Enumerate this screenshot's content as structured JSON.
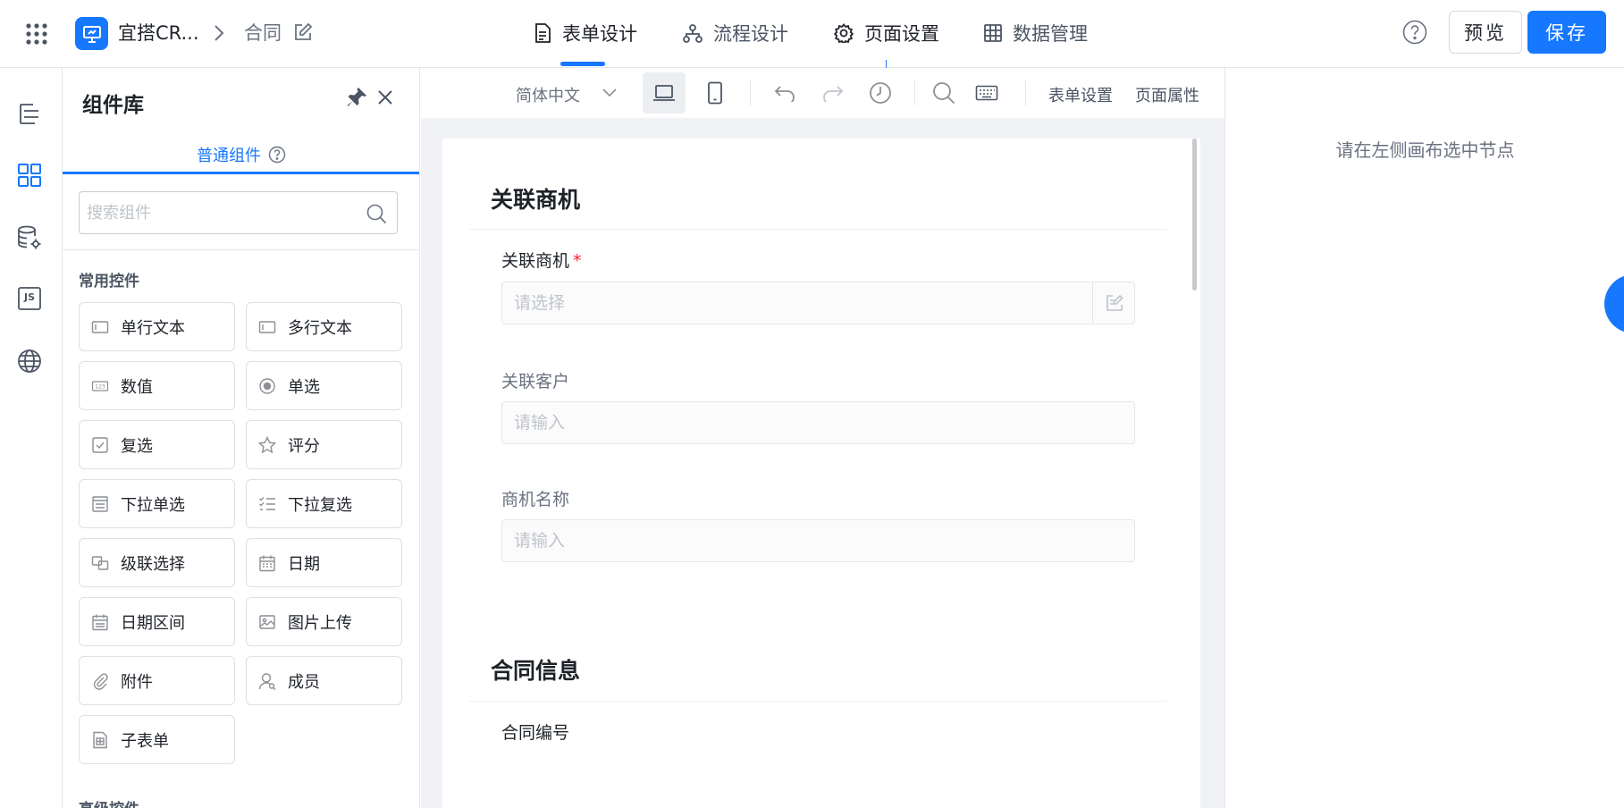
{
  "header": {
    "app_name": "宜搭CR...",
    "page_name": "合同",
    "tabs": [
      {
        "label": "表单设计",
        "icon": "document-icon",
        "active": true
      },
      {
        "label": "流程设计",
        "icon": "flow-icon",
        "active": false
      },
      {
        "label": "页面设置",
        "icon": "gear-icon",
        "active": false
      },
      {
        "label": "数据管理",
        "icon": "table-icon",
        "active": false
      }
    ],
    "preview_label": "预览",
    "save_label": "保存",
    "accent_color": "#1677ff"
  },
  "left_rail": {
    "items": [
      "outline-icon",
      "components-icon",
      "datasource-icon",
      "js-icon",
      "globe-icon"
    ],
    "js_label": "JS"
  },
  "component_panel": {
    "title": "组件库",
    "tab_label": "普通组件",
    "search_placeholder": "搜索组件",
    "common_section_label": "常用控件",
    "advanced_section_label": "高级控件",
    "components": [
      {
        "label": "单行文本",
        "icon": "single-line-text-icon"
      },
      {
        "label": "多行文本",
        "icon": "multi-line-text-icon"
      },
      {
        "label": "数值",
        "icon": "number-icon"
      },
      {
        "label": "单选",
        "icon": "radio-icon"
      },
      {
        "label": "复选",
        "icon": "checkbox-icon"
      },
      {
        "label": "评分",
        "icon": "star-icon"
      },
      {
        "label": "下拉单选",
        "icon": "dropdown-select-icon"
      },
      {
        "label": "下拉复选",
        "icon": "dropdown-multiselect-icon"
      },
      {
        "label": "级联选择",
        "icon": "cascade-icon"
      },
      {
        "label": "日期",
        "icon": "date-icon"
      },
      {
        "label": "日期区间",
        "icon": "date-range-icon"
      },
      {
        "label": "图片上传",
        "icon": "image-upload-icon"
      },
      {
        "label": "附件",
        "icon": "attachment-icon"
      },
      {
        "label": "成员",
        "icon": "member-icon"
      },
      {
        "label": "子表单",
        "icon": "subform-icon"
      }
    ]
  },
  "canvas_toolbar": {
    "language": "简体中文",
    "form_settings_label": "表单设置",
    "page_props_label": "页面属性"
  },
  "form": {
    "sections": [
      {
        "title": "关联商机",
        "fields": [
          {
            "label": "关联商机",
            "required": true,
            "placeholder": "请选择"
          },
          {
            "label": "关联客户",
            "required": false,
            "placeholder": "请输入"
          },
          {
            "label": "商机名称",
            "required": false,
            "placeholder": "请输入"
          }
        ]
      },
      {
        "title": "合同信息",
        "fields": [
          {
            "label": "合同编号",
            "required": false
          }
        ]
      }
    ],
    "required_mark": "*"
  },
  "right_panel": {
    "hint": "请在左侧画布选中节点"
  }
}
